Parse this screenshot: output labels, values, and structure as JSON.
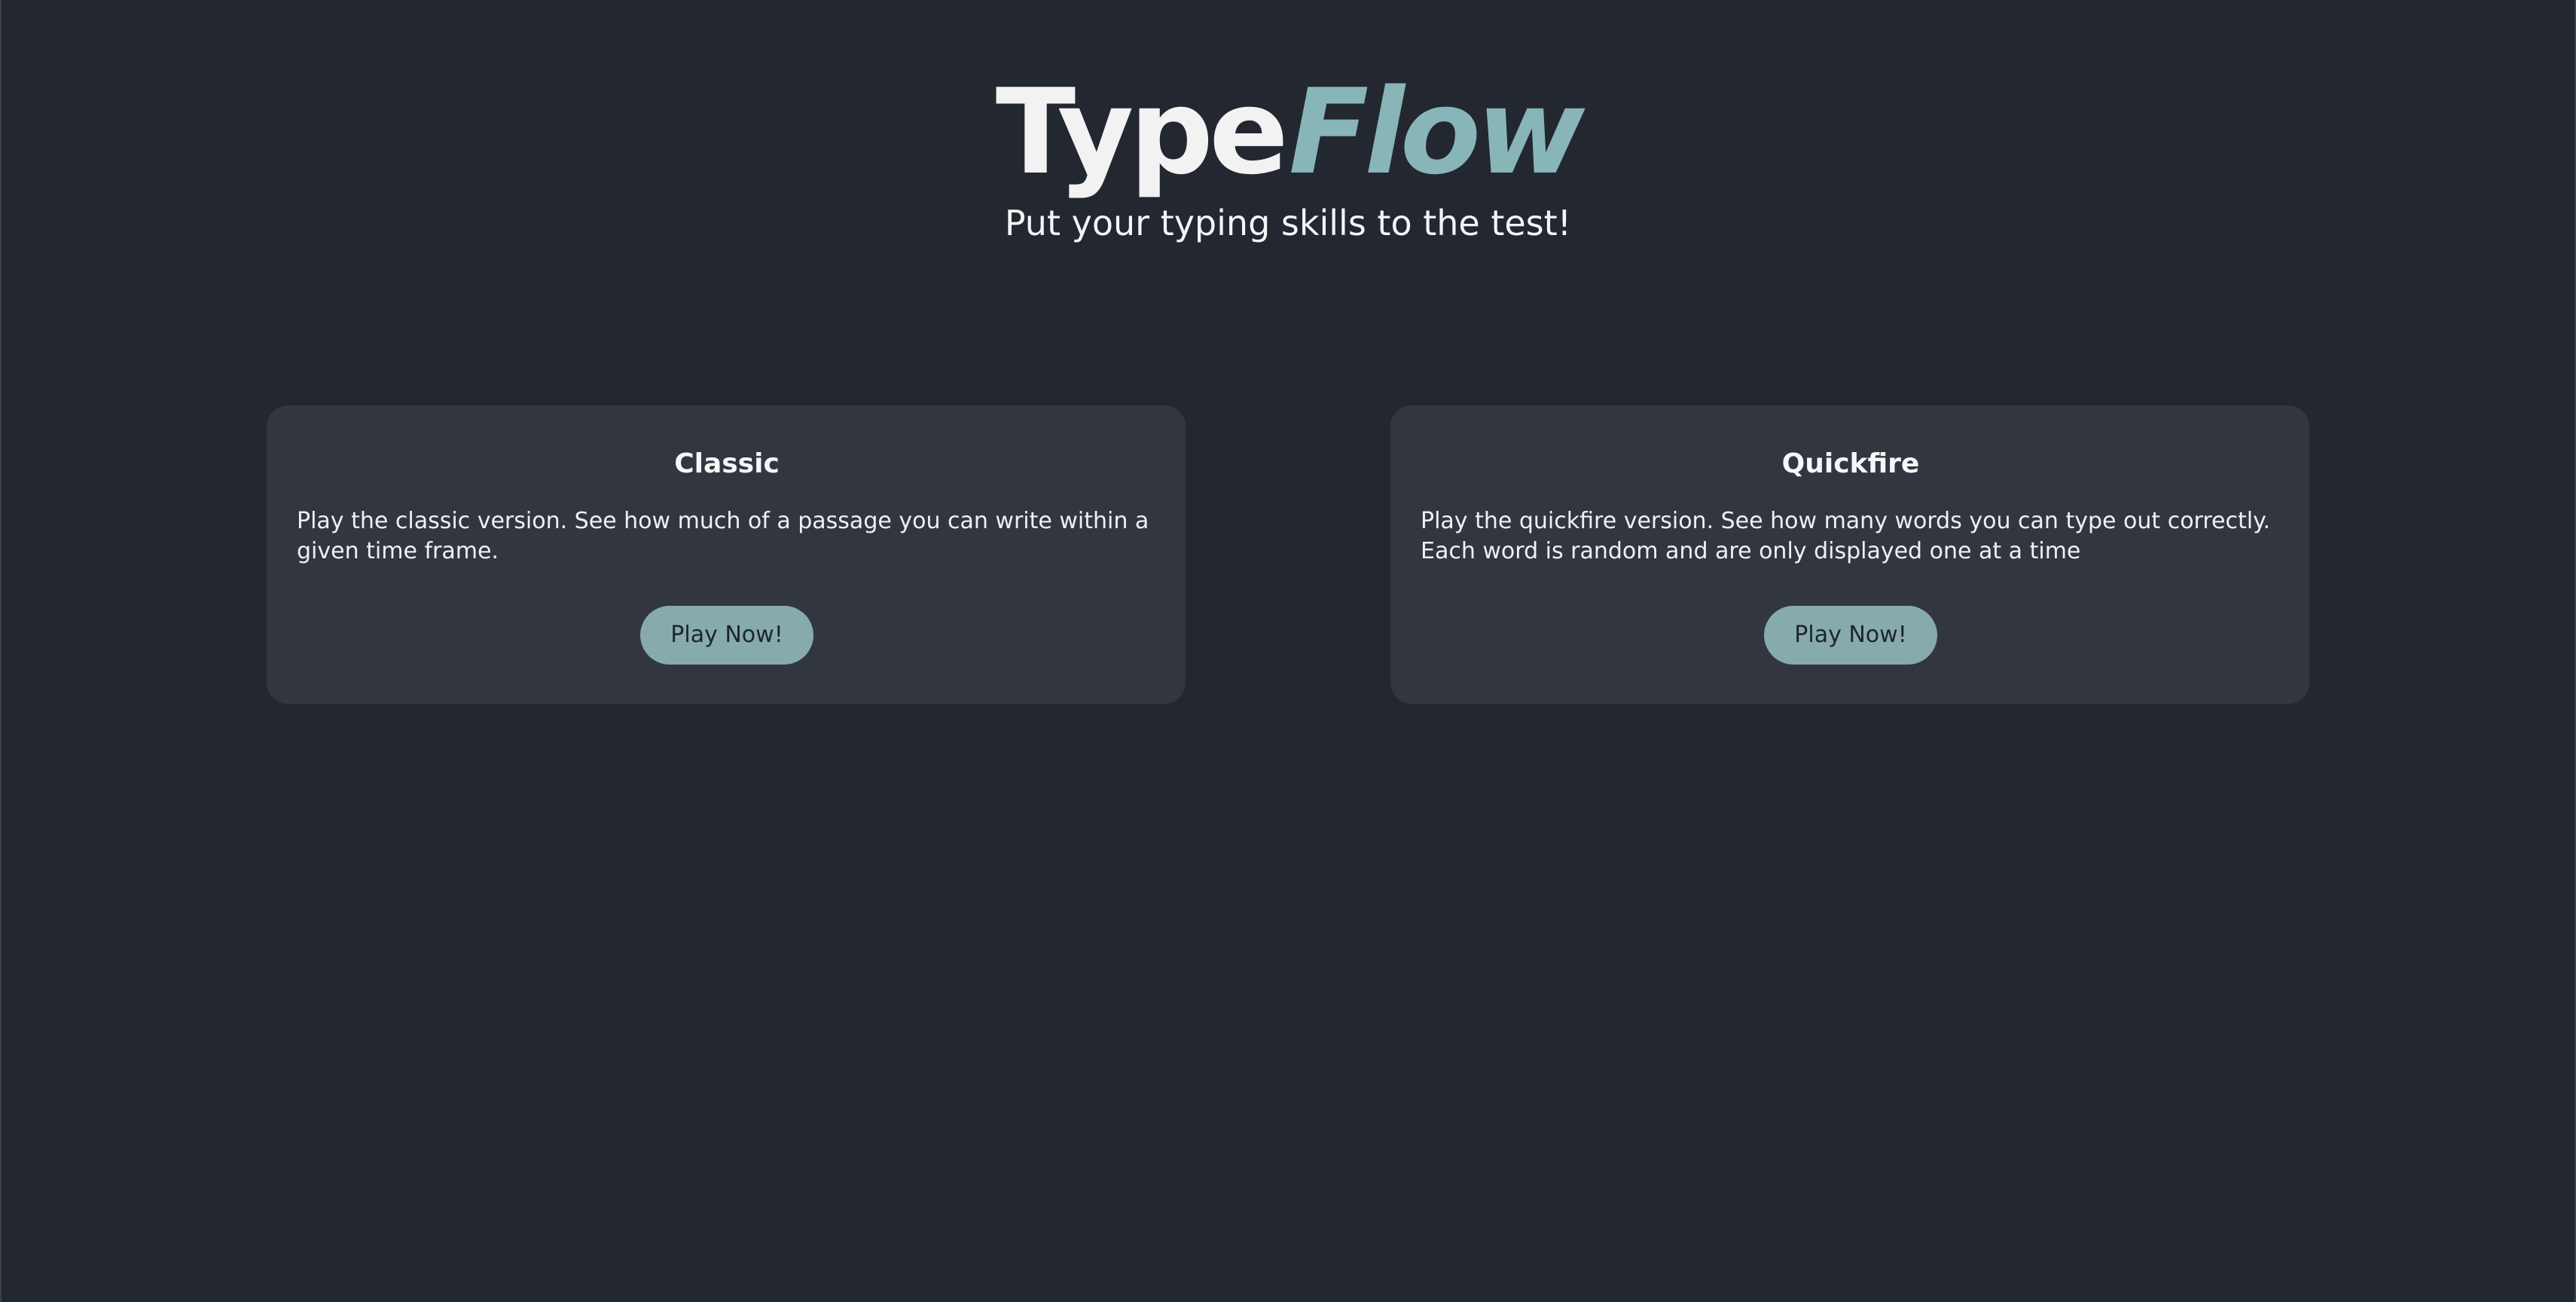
{
  "header": {
    "brand_type": "Type",
    "brand_flow": "Flow",
    "tagline": "Put your typing skills to the test!"
  },
  "modes": [
    {
      "title": "Classic",
      "description": "Play the classic version. See how much of a passage you can write within a given time frame.",
      "button_label": "Play Now!"
    },
    {
      "title": "Quickfire",
      "description": "Play the quickfire version. See how many words you can type out correctly. Each word is random and are only displayed one at a time",
      "button_label": "Play Now!"
    }
  ],
  "colors": {
    "background": "#232730",
    "card": "#32363f",
    "accent": "#88b5b8",
    "button": "#87abac"
  }
}
